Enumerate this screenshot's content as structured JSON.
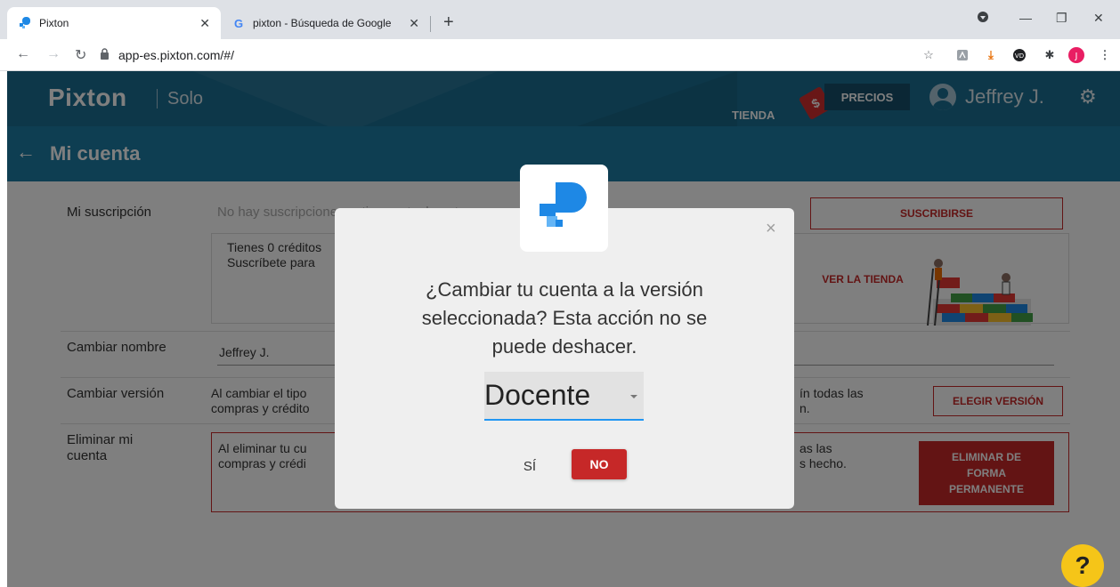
{
  "browser": {
    "tabs": [
      {
        "title": "Pixton",
        "favicon": "pixton-favicon",
        "active": true
      },
      {
        "title": "pixton - Búsqueda de Google",
        "favicon": "google-favicon",
        "active": false
      }
    ],
    "url": "app-es.pixton.com/#/"
  },
  "header": {
    "logo": "Pixton",
    "plan": "Solo",
    "store_label": "TIENDA",
    "prices_label": "PRECIOS",
    "price_tag_symbol": "$",
    "user_name": "Jeffrey J."
  },
  "subheader": {
    "title": "Mi cuenta"
  },
  "account": {
    "subscription": {
      "label": "Mi suscripción",
      "status": "No hay suscripciones activas actualmente",
      "subscribe_label": "SUSCRIBIRSE",
      "credits_line1": "Tienes 0 créditos",
      "credits_line2": "Suscríbete para",
      "store_label": "VER LA TIENDA"
    },
    "rename": {
      "label": "Cambiar nombre",
      "value": "Jeffrey J."
    },
    "version": {
      "label": "Cambiar versión",
      "line1": "Al cambiar el tipo",
      "line2": "compras y crédito",
      "line1_right": "ín todas las",
      "line2_right": "n.",
      "button_label": "ELEGIR VERSIÓN"
    },
    "delete": {
      "label_line1": "Eliminar mi",
      "label_line2": "cuenta",
      "line1": "Al eliminar tu cu",
      "line2": "compras y crédi",
      "line1_right": "as las",
      "line2_right": "s hecho.",
      "button_line1": "ELIMINAR DE",
      "button_line2": "FORMA",
      "button_line3": "PERMANENTE"
    }
  },
  "modal": {
    "message_line1": "¿Cambiar tu cuenta a la versión",
    "message_line2": "seleccionada? Esta acción no se",
    "message_line3": "puede deshacer.",
    "selected_version": "Docente",
    "yes_label": "SÍ",
    "no_label": "NO",
    "close_symbol": "×"
  },
  "help": {
    "symbol": "?"
  },
  "colors": {
    "header_blue": "#1b6f93",
    "subheader_blue": "#1d7ca4",
    "accent_red": "#c62828",
    "help_yellow": "#f5c518",
    "pixton_blue": "#1e88e5"
  }
}
